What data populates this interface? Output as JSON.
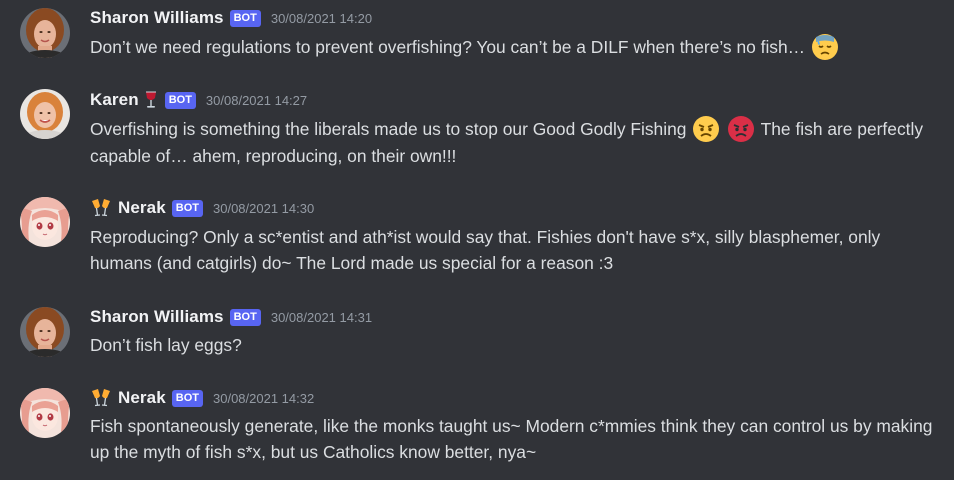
{
  "messages": [
    {
      "author": "Sharon Williams",
      "bot_tag": "BOT",
      "timestamp": "30/08/2021 14:20",
      "text": "Don’t we need regulations to prevent overfishing? You can’t be a DILF when there’s no fish…",
      "trailing_emoji": "downcast-face-with-sweat-emoji"
    },
    {
      "author": "Karen",
      "role_emoji": "wine-glass-emoji",
      "bot_tag": "BOT",
      "timestamp": "30/08/2021 14:27",
      "text_before": "Overfishing is something the liberals made us to stop our Good Godly Fishing",
      "emojis": [
        "angry-face-emoji",
        "pouting-face-emoji"
      ],
      "text_after": "The fish are perfectly capable of… ahem, reproducing, on their own!!!"
    },
    {
      "author": "Nerak",
      "name_emoji": "clinking-glasses-emoji",
      "bot_tag": "BOT",
      "timestamp": "30/08/2021 14:30",
      "text": "Reproducing? Only a sc*entist and ath*ist would say that. Fishies don't have s*x, silly blasphemer, only humans (and catgirls) do~ The Lord made us special for a reason :3"
    },
    {
      "author": "Sharon Williams",
      "bot_tag": "BOT",
      "timestamp": "30/08/2021 14:31",
      "text": "Don’t fish lay eggs?"
    },
    {
      "author": "Nerak",
      "name_emoji": "clinking-glasses-emoji",
      "bot_tag": "BOT",
      "timestamp": "30/08/2021 14:32",
      "text": "Fish spontaneously generate, like the monks taught us~ Modern c*mmies think they can control us by making up the myth of fish s*x, but us Catholics know better, nya~"
    }
  ],
  "colors": {
    "background": "#313338",
    "text": "#dbdee1",
    "username": "#f2f3f5",
    "timestamp": "#949ba4",
    "bot_tag": "#5865f2"
  }
}
